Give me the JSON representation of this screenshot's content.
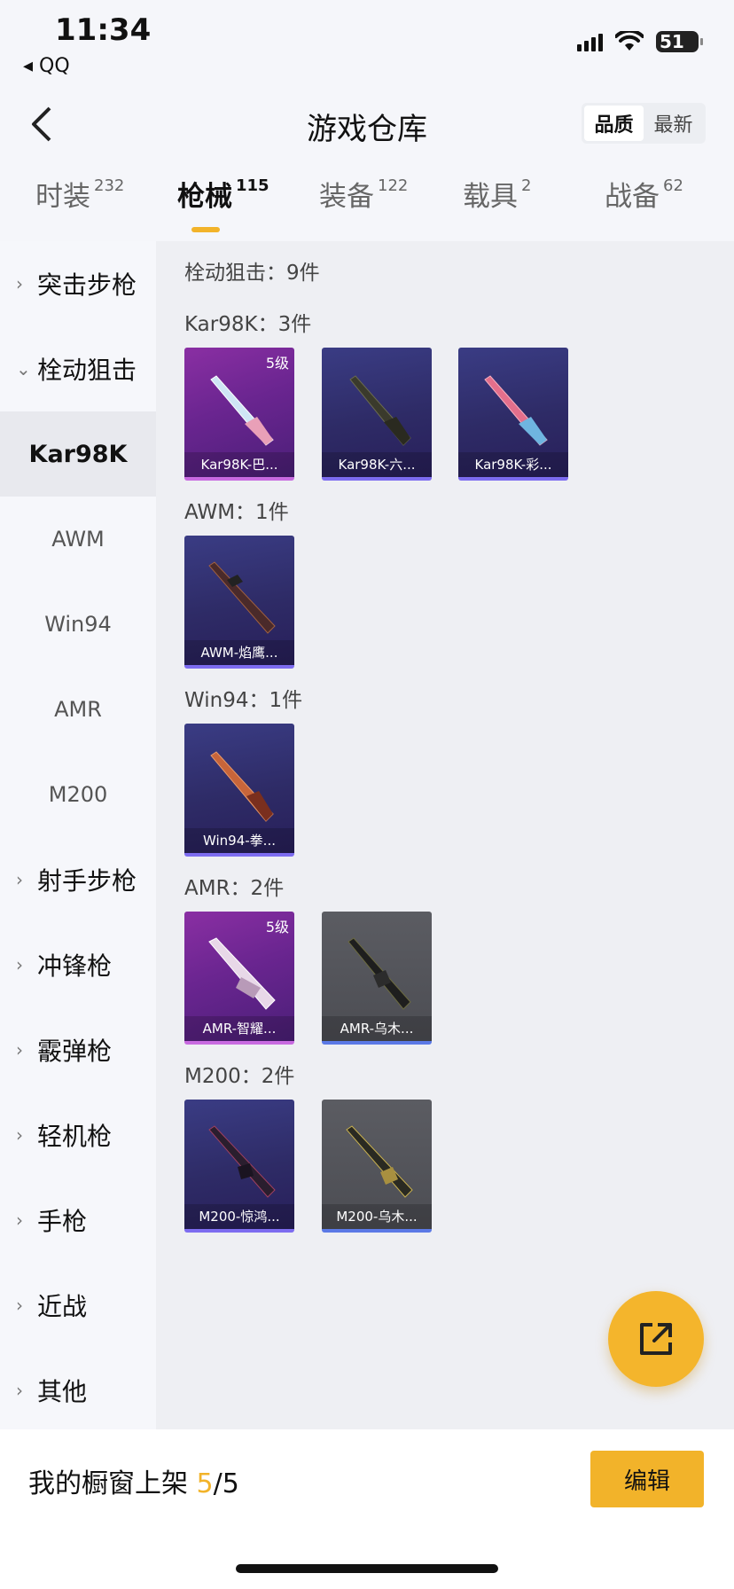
{
  "status_bar": {
    "time": "11:34",
    "back_app": "◂ QQ",
    "battery": "51"
  },
  "header": {
    "title": "游戏仓库",
    "sort_options": [
      "品质",
      "最新"
    ]
  },
  "tabs": [
    {
      "label": "时装",
      "count": "232"
    },
    {
      "label": "枪械",
      "count": "115"
    },
    {
      "label": "装备",
      "count": "122"
    },
    {
      "label": "载具",
      "count": "2"
    },
    {
      "label": "战备",
      "count": "62"
    }
  ],
  "sidebar": {
    "categories": [
      "突击步枪",
      "栓动狙击",
      "射手步枪",
      "冲锋枪",
      "霰弹枪",
      "轻机枪",
      "手枪",
      "近战",
      "其他"
    ],
    "sub_items": [
      "Kar98K",
      "AWM",
      "Win94",
      "AMR",
      "M200"
    ]
  },
  "content": {
    "group_title": "栓动狙击：9件",
    "sections": [
      {
        "title": "Kar98K：3件",
        "items": [
          {
            "name": "Kar98K-巴...",
            "level": "5级"
          },
          {
            "name": "Kar98K-六..."
          },
          {
            "name": "Kar98K-彩..."
          }
        ]
      },
      {
        "title": "AWM：1件",
        "items": [
          {
            "name": "AWM-焰鹰..."
          }
        ]
      },
      {
        "title": "Win94：1件",
        "items": [
          {
            "name": "Win94-拳..."
          }
        ]
      },
      {
        "title": "AMR：2件",
        "items": [
          {
            "name": "AMR-智耀...",
            "level": "5级"
          },
          {
            "name": "AMR-乌木..."
          }
        ]
      },
      {
        "title": "M200：2件",
        "items": [
          {
            "name": "M200-惊鸿..."
          },
          {
            "name": "M200-乌木..."
          }
        ]
      }
    ]
  },
  "bottom": {
    "shelf_label": "我的橱窗上架 ",
    "shelf_count": "5",
    "shelf_total": "/5",
    "edit_label": "编辑"
  },
  "colors": {
    "accent": "#f2b32a",
    "legendary": "#8a2fa3",
    "epic": "#3a3c84",
    "rare": "#5b5c62"
  }
}
